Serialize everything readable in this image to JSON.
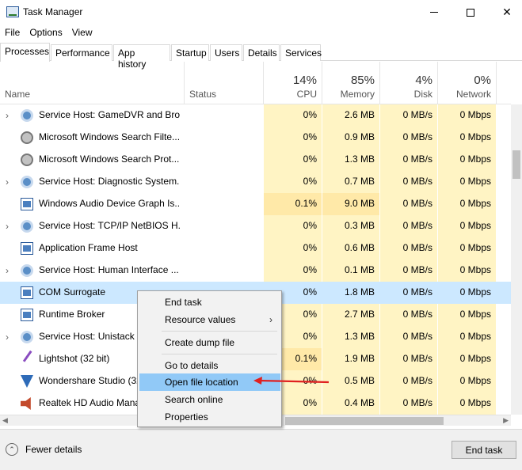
{
  "window": {
    "title": "Task Manager"
  },
  "menu": [
    "File",
    "Options",
    "View"
  ],
  "tabs": [
    "Processes",
    "Performance",
    "App history",
    "Startup",
    "Users",
    "Details",
    "Services"
  ],
  "columns": {
    "name": "Name",
    "status": "Status",
    "cpu": {
      "pct": "14%",
      "label": "CPU"
    },
    "memory": {
      "pct": "85%",
      "label": "Memory"
    },
    "disk": {
      "pct": "4%",
      "label": "Disk"
    },
    "network": {
      "pct": "0%",
      "label": "Network"
    }
  },
  "rows": [
    {
      "name": "Service Host: GameDVR and Bro...",
      "cpu": "0%",
      "mem": "2.6 MB",
      "disk": "0 MB/s",
      "net": "0 Mbps",
      "icon": "gear-icon"
    },
    {
      "name": "Microsoft Windows Search Filte...",
      "cpu": "0%",
      "mem": "0.9 MB",
      "disk": "0 MB/s",
      "net": "0 Mbps",
      "icon": "user-icon"
    },
    {
      "name": "Microsoft Windows Search Prot...",
      "cpu": "0%",
      "mem": "1.3 MB",
      "disk": "0 MB/s",
      "net": "0 Mbps",
      "icon": "user-icon"
    },
    {
      "name": "Service Host: Diagnostic System...",
      "cpu": "0%",
      "mem": "0.7 MB",
      "disk": "0 MB/s",
      "net": "0 Mbps",
      "icon": "gear-icon"
    },
    {
      "name": "Windows Audio Device Graph Is...",
      "cpu": "0.1%",
      "mem": "9.0 MB",
      "disk": "0 MB/s",
      "net": "0 Mbps",
      "icon": "window-icon"
    },
    {
      "name": "Service Host: TCP/IP NetBIOS H...",
      "cpu": "0%",
      "mem": "0.3 MB",
      "disk": "0 MB/s",
      "net": "0 Mbps",
      "icon": "gear-icon"
    },
    {
      "name": "Application Frame Host",
      "cpu": "0%",
      "mem": "0.6 MB",
      "disk": "0 MB/s",
      "net": "0 Mbps",
      "icon": "window-icon"
    },
    {
      "name": "Service Host: Human Interface ...",
      "cpu": "0%",
      "mem": "0.1 MB",
      "disk": "0 MB/s",
      "net": "0 Mbps",
      "icon": "gear-icon"
    },
    {
      "name": "COM Surrogate",
      "cpu": "0%",
      "mem": "1.8 MB",
      "disk": "0 MB/s",
      "net": "0 Mbps",
      "icon": "window-icon"
    },
    {
      "name": "Runtime Broker",
      "cpu": "0%",
      "mem": "2.7 MB",
      "disk": "0 MB/s",
      "net": "0 Mbps",
      "icon": "window-icon"
    },
    {
      "name": "Service Host: Unistack S",
      "cpu": "0%",
      "mem": "1.3 MB",
      "disk": "0 MB/s",
      "net": "0 Mbps",
      "icon": "gear-icon"
    },
    {
      "name": "Lightshot (32 bit)",
      "cpu": "0.1%",
      "mem": "1.9 MB",
      "disk": "0 MB/s",
      "net": "0 Mbps",
      "icon": "lightshot-icon"
    },
    {
      "name": "Wondershare Studio (32",
      "cpu": "0%",
      "mem": "0.5 MB",
      "disk": "0 MB/s",
      "net": "0 Mbps",
      "icon": "wondershare-icon"
    },
    {
      "name": "Realtek HD Audio Mana",
      "cpu": "0%",
      "mem": "0.4 MB",
      "disk": "0 MB/s",
      "net": "0 Mbps",
      "icon": "speaker-icon"
    }
  ],
  "context_menu": {
    "end_task": "End task",
    "resource_values": "Resource values",
    "create_dump": "Create dump file",
    "go_to_details": "Go to details",
    "open_file_location": "Open file location",
    "search_online": "Search online",
    "properties": "Properties"
  },
  "footer": {
    "fewer_details": "Fewer details",
    "end_task": "End task"
  },
  "colors": {
    "selected_row": "#cce8ff",
    "heat_cell": "#fff4c4",
    "menu_highlight": "#91c9f7",
    "annotation_arrow": "#e02020"
  }
}
